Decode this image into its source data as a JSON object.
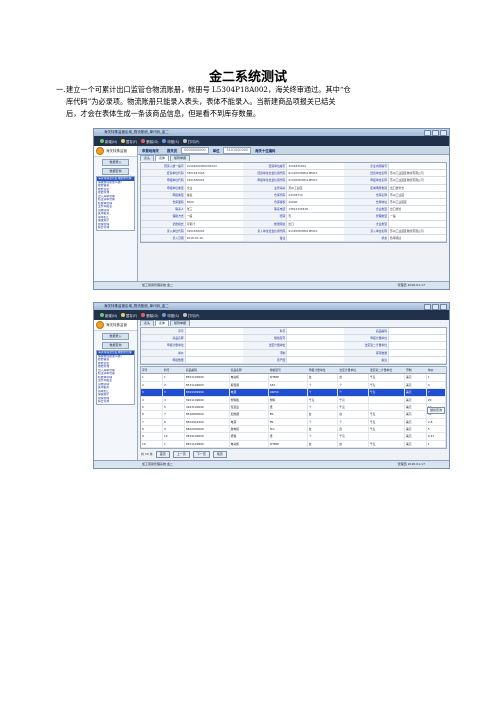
{
  "doc": {
    "title": "金二系统测试",
    "question_number": "一.",
    "question_lines": [
      "建立一个可累计出口监管仓物流账册，帐册号 L5304P18A002，海关终审通过。其中“仓",
      "库代码”为必录项。物流账册只能录入表头，表体不能录入。当新建商品项报关已结关",
      "后，才会在表体生成一条该商品信息，但是看不到库存数量。"
    ]
  },
  "screen1": {
    "window_title": "海关特殊监管区域_物流账册_单代码_金二",
    "toolbar": [
      {
        "label": "新增(N)",
        "color": "#6fc36f"
      },
      {
        "label": "暂存(F)",
        "color": "#e8d060"
      },
      {
        "label": "删除(D)",
        "color": "#e06060"
      },
      {
        "label": "申报(S)",
        "color": "#60a0e0"
      },
      {
        "label": "打印(P)",
        "color": "#c0c0c0"
      }
    ],
    "logo_text": "海关特殊监管",
    "side_buttons": [
      "数据录入",
      "数据查询"
    ],
    "tree_items": [
      "海关特殊监管区域账册管理",
      "保税物流账册(A类)",
      "账册备案",
      "账册变更",
      "账册查询",
      "出入库单管理",
      "核注清单管理",
      "核放单管理",
      "业务申报表",
      "货物流转",
      "集中报关",
      "简单加工",
      "保税展示",
      "担保管理",
      "综合查询"
    ],
    "header": {
      "label1": "申报地海关",
      "field1": "报关员",
      "field2": "业务员",
      "label2": "单位",
      "label3": "海关十位编码",
      "box1": "0000000000",
      "box2": "5101000000"
    },
    "tabs": [
      "表头",
      "表体",
      "随附单据"
    ],
    "form_rows": [
      [
        [
          "预录入统一编号",
          "L5304000000005243"
        ],
        [
          "经营单位编号",
          "3201830001"
        ],
        [
          "企业内部编号",
          ""
        ]
      ],
      [
        [
          "经营单位代码",
          "3301947005"
        ],
        [
          "经营单位社会信用代码",
          "91320508MA1MMXX"
        ],
        [
          "经营单位名称",
          "苏州工业园区物流有限公司"
        ]
      ],
      [
        [
          "申报单位代码",
          "3201830001"
        ],
        [
          "申报单位社会信用代码",
          "91320583MA1MMXX"
        ],
        [
          "申报单位名称",
          "苏州工业园区物流有限公司"
        ]
      ],
      [
        [
          "申报单位类型",
          "企业"
        ],
        [
          "主管海关",
          "苏州工业园"
        ],
        [
          "区域场所类别",
          "出口监管仓"
        ]
      ],
      [
        [
          "申报类型",
          "备案"
        ],
        [
          "仓库代码",
          "A3304710"
        ],
        [
          "仓库名称",
          "苏州工业园"
        ]
      ],
      [
        [
          "仓库面积",
          "5000"
        ],
        [
          "仓库容积",
          "10000"
        ],
        [
          "仓库地址",
          "苏州工业园区"
        ]
      ],
      [
        [
          "联系人",
          "张三"
        ],
        [
          "联系电话",
          "13812345678"
        ],
        [
          "企业类型",
          "出口监管"
        ]
      ],
      [
        [
          "保税方式",
          "一般"
        ],
        [
          "结转",
          "否"
        ],
        [
          "管理类型",
          "一般"
        ]
      ],
      [
        [
          "记账模式",
          "可累计"
        ],
        [
          "帐册用途",
          "出口"
        ],
        [
          "企业类型",
          ""
        ]
      ],
      [
        [
          "录入单位代码",
          "3201830001"
        ],
        [
          "录入单位社会信用代码",
          "91320583MA1MMXX"
        ],
        [
          "录入单位名称",
          "苏州工业园区物流有限公司"
        ]
      ],
      [
        [
          "录入日期",
          "2018-01-16"
        ],
        [
          "备注",
          ""
        ],
        [
          "状态",
          "终审通过"
        ]
      ]
    ],
    "status_left": "加工贸易管理系统  金二",
    "status_right": "管理员  2018-01-17"
  },
  "screen2": {
    "window_title": "海关特殊监管区域_物流账册_单代码_金二",
    "tabs": [
      "表头",
      "表体",
      "随附单据"
    ],
    "form_rows": [
      [
        [
          "序号",
          ""
        ],
        [
          "料号",
          ""
        ],
        [
          "商品编码",
          ""
        ]
      ],
      [
        [
          "商品名称",
          ""
        ],
        [
          "规格型号",
          ""
        ],
        [
          "申报计量单位",
          ""
        ]
      ],
      [
        [
          "申报计量单位",
          ""
        ],
        [
          "法定计量单位",
          ""
        ],
        [
          "法定第二计量单位",
          ""
        ]
      ],
      [
        [
          "单价",
          ""
        ],
        [
          "币制",
          ""
        ],
        [
          "库存数量",
          ""
        ]
      ],
      [
        [
          "申报数量",
          ""
        ],
        [
          "原产国",
          ""
        ],
        [
          "备注",
          ""
        ]
      ]
    ],
    "grid_headers": [
      "序号",
      "料号",
      "商品编码",
      "商品名称",
      "规格型号",
      "申报计量单位",
      "法定计量单位",
      "法定第二计量单位",
      "币制",
      "单价"
    ],
    "grid_rows": [
      [
        "1",
        "1",
        "8501109990",
        "电动机",
        "SH5RE",
        "台",
        "台",
        "千克",
        "美元",
        "1"
      ],
      [
        "2",
        "2",
        "8531109000",
        "报警器",
        "S34",
        "个",
        "个",
        "千克",
        "美元",
        "3"
      ],
      [
        "3",
        "3",
        "8504409999",
        "电源",
        "ASP50",
        "个",
        "个",
        "千克",
        "美元",
        "7"
      ],
      [
        "4",
        "4",
        "3921109090",
        "塑料板",
        "塑料",
        "千克",
        "千克",
        "",
        "美元",
        "20"
      ],
      [
        "5",
        "5",
        "3923100090",
        "包装盒",
        "纸",
        "个",
        "千克",
        "",
        "美元",
        "10"
      ],
      [
        "6",
        "7",
        "8516800000",
        "加热器",
        "ER",
        "台",
        "台",
        "千克",
        "美元",
        "50"
      ],
      [
        "7",
        "8",
        "8504401900",
        "电源",
        "FN",
        "个",
        "个",
        "千克",
        "美元",
        "2.8"
      ],
      [
        "8",
        "9",
        "8502000000",
        "发电机",
        "Std",
        "台",
        "台",
        "千克",
        "美元",
        "5"
      ],
      [
        "9",
        "10",
        "4819100000",
        "纸箱",
        "纸",
        "个",
        "千克",
        "",
        "美元",
        "0.47"
      ],
      [
        "10",
        "1",
        "8501109990",
        "电动机",
        "SH5RE",
        "台",
        "台",
        "千克",
        "美元",
        "1"
      ]
    ],
    "side_button": "继续查询",
    "pager": {
      "page_info": "共 10 条",
      "first": "首页",
      "prev": "上一页",
      "next": "下一页",
      "last": "尾页"
    },
    "status_left": "加工贸易管理系统  金二",
    "status_right": "管理员  2018-01-17"
  }
}
